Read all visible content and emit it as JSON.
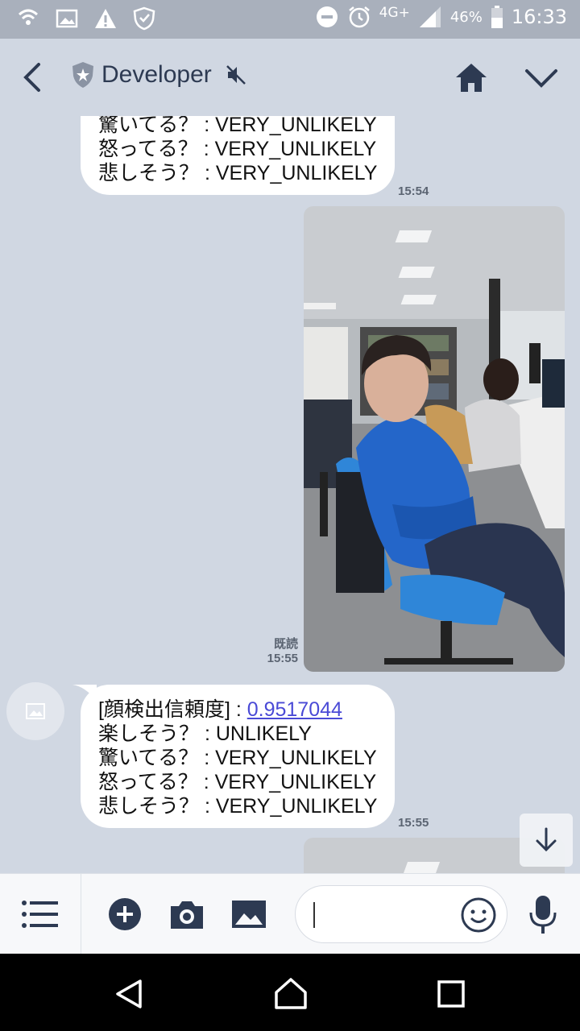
{
  "status_bar": {
    "network": "4G+",
    "battery": "46%",
    "time": "16:33",
    "icons": [
      "wifi-calling-icon",
      "image-icon",
      "warning-icon",
      "shield-icon",
      "do-not-disturb-icon",
      "alarm-icon",
      "signal-icon",
      "battery-icon"
    ]
  },
  "header": {
    "title": "Developer",
    "icons": [
      "back-icon",
      "official-badge-icon",
      "mute-icon",
      "home-icon",
      "chevron-down-icon"
    ]
  },
  "messages": [
    {
      "sender": "bot",
      "lines": [
        "驚いてる？ : VERY_UNLIKELY",
        "怒ってる？ : VERY_UNLIKELY",
        "悲しそう？ : VERY_UNLIKELY"
      ],
      "time": "15:54"
    },
    {
      "sender": "me",
      "type": "photo",
      "read_label": "既読",
      "time": "15:55"
    },
    {
      "sender": "bot",
      "label_prefix": "[顔検出信頼度] : ",
      "confidence": "0.9517044",
      "lines": [
        "楽しそう？ : UNLIKELY",
        "驚いてる？ : VERY_UNLIKELY",
        "怒ってる？ : VERY_UNLIKELY",
        "悲しそう？ : VERY_UNLIKELY"
      ],
      "time": "15:55"
    }
  ],
  "input_bar": {
    "icons": [
      "menu-icon",
      "plus-icon",
      "camera-icon",
      "image-icon",
      "emoji-icon",
      "mic-icon"
    ]
  },
  "nav_bar": {
    "icons": [
      "nav-back-icon",
      "nav-home-icon",
      "nav-recent-icon"
    ]
  },
  "colors": {
    "chat_background": "#d0d7e2",
    "header_text": "#2d3a52",
    "link": "#4a4ad6",
    "status_bar": "#a9b0bc"
  }
}
